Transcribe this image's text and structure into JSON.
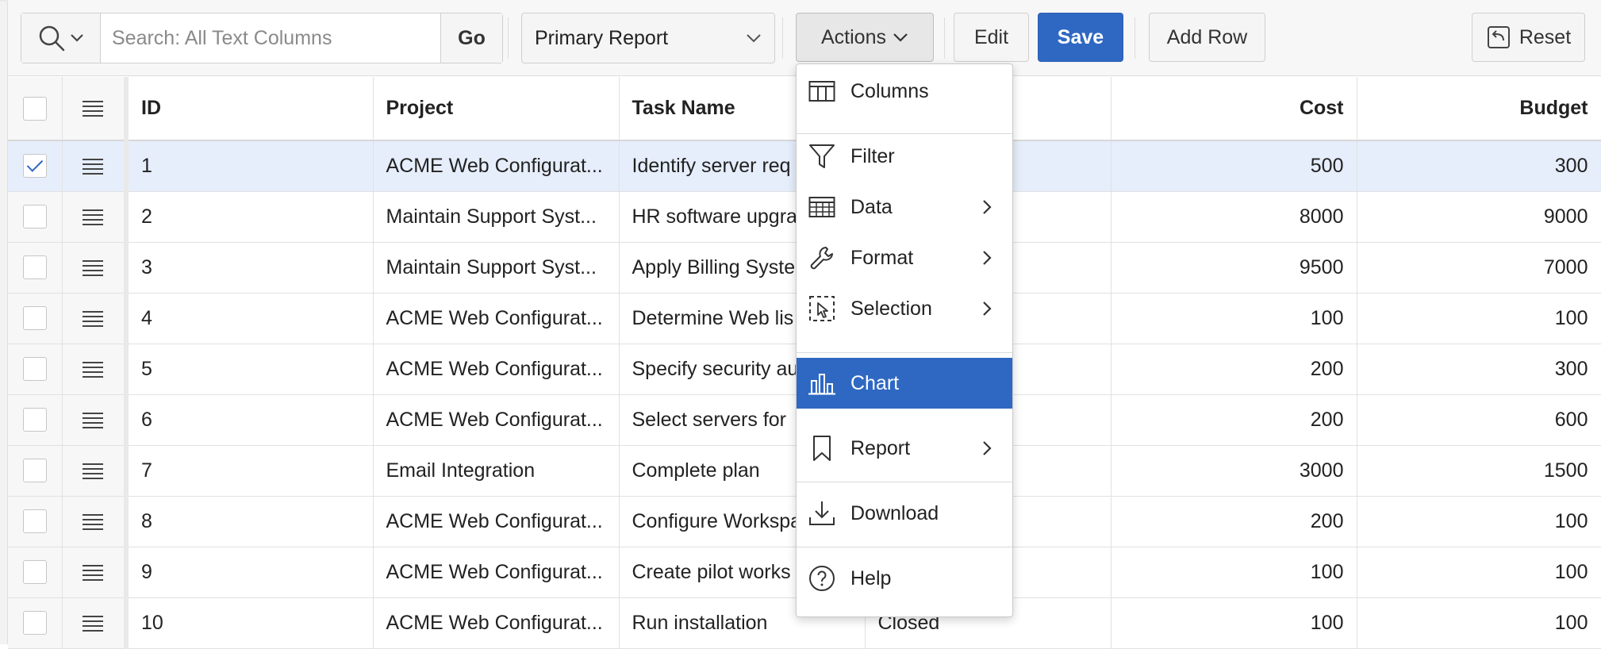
{
  "toolbar": {
    "search_placeholder": "Search: All Text Columns",
    "go_label": "Go",
    "report_label": "Primary Report",
    "actions_label": "Actions",
    "edit_label": "Edit",
    "save_label": "Save",
    "add_row_label": "Add Row",
    "reset_label": "Reset"
  },
  "grid": {
    "columns": [
      "ID",
      "Project",
      "Task Name",
      "Cost",
      "Budget"
    ],
    "rows": [
      {
        "id": "1",
        "project": "ACME Web Configurat...",
        "task": "Identify server req",
        "status": "",
        "cost": "500",
        "budget": "300",
        "selected": true
      },
      {
        "id": "2",
        "project": "Maintain Support Syst...",
        "task": "HR software upgra",
        "status": "",
        "cost": "8000",
        "budget": "9000",
        "selected": false
      },
      {
        "id": "3",
        "project": "Maintain Support Syst...",
        "task": "Apply Billing Syste",
        "status": "",
        "cost": "9500",
        "budget": "7000",
        "selected": false
      },
      {
        "id": "4",
        "project": "ACME Web Configurat...",
        "task": "Determine Web lis",
        "status": "",
        "cost": "100",
        "budget": "100",
        "selected": false
      },
      {
        "id": "5",
        "project": "ACME Web Configurat...",
        "task": "Specify security au",
        "status": "",
        "cost": "200",
        "budget": "300",
        "selected": false
      },
      {
        "id": "6",
        "project": "ACME Web Configurat...",
        "task": "Select servers for",
        "status": "",
        "cost": "200",
        "budget": "600",
        "selected": false
      },
      {
        "id": "7",
        "project": "Email Integration",
        "task": "Complete plan",
        "status": "",
        "cost": "3000",
        "budget": "1500",
        "selected": false
      },
      {
        "id": "8",
        "project": "ACME Web Configurat...",
        "task": "Configure Workspa",
        "status": "",
        "cost": "200",
        "budget": "100",
        "selected": false
      },
      {
        "id": "9",
        "project": "ACME Web Configurat...",
        "task": "Create pilot works",
        "status": "",
        "cost": "100",
        "budget": "100",
        "selected": false
      },
      {
        "id": "10",
        "project": "ACME Web Configurat...",
        "task": "Run installation",
        "status": "Closed",
        "cost": "100",
        "budget": "100",
        "selected": false
      }
    ]
  },
  "actions_menu": {
    "items": [
      {
        "label": "Columns",
        "icon": "columns-icon",
        "submenu": false,
        "active": false
      },
      {
        "label": "Filter",
        "icon": "filter-icon",
        "submenu": false,
        "active": false
      },
      {
        "label": "Data",
        "icon": "data-icon",
        "submenu": true,
        "active": false
      },
      {
        "label": "Format",
        "icon": "wrench-icon",
        "submenu": true,
        "active": false
      },
      {
        "label": "Selection",
        "icon": "selection-icon",
        "submenu": true,
        "active": false
      },
      {
        "label": "Chart",
        "icon": "chart-icon",
        "submenu": false,
        "active": true
      },
      {
        "label": "Report",
        "icon": "bookmark-icon",
        "submenu": true,
        "active": false
      },
      {
        "label": "Download",
        "icon": "download-icon",
        "submenu": false,
        "active": false
      },
      {
        "label": "Help",
        "icon": "help-icon",
        "submenu": false,
        "active": false
      }
    ]
  },
  "colors": {
    "accent": "#2f68c2",
    "selected_row": "#e6eefb",
    "toolbar_bg": "#f7f7f7"
  }
}
